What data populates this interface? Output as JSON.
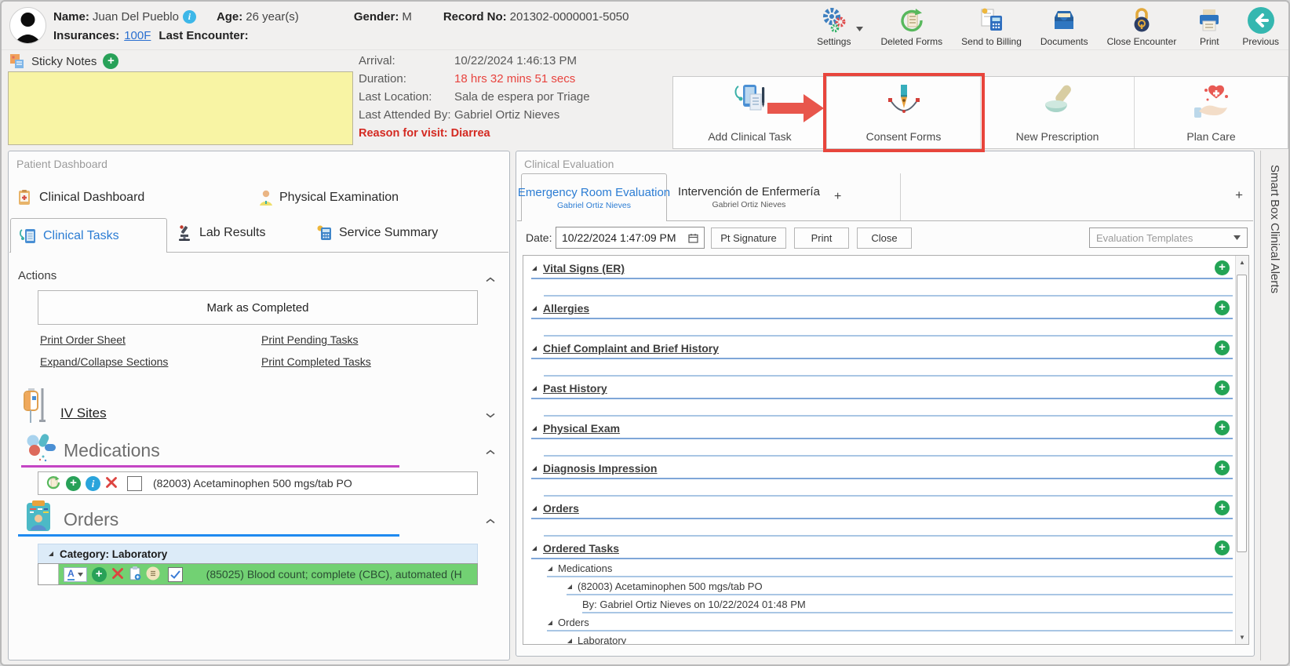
{
  "patient_header": {
    "name_label": "Name:",
    "name": "Juan Del Pueblo",
    "age_label": "Age:",
    "age": "26 year(s)",
    "gender_label": "Gender:",
    "gender": "M",
    "record_label": "Record No:",
    "record": "201302-0000001-5050",
    "insurances_label": "Insurances:",
    "insurances": "100F",
    "last_encounter_label": "Last Encounter:"
  },
  "toolbar": {
    "settings": "Settings",
    "deleted_forms": "Deleted Forms",
    "send_to_billing": "Send to Billing",
    "documents": "Documents",
    "close_encounter": "Close Encounter",
    "print": "Print",
    "previous": "Previous"
  },
  "sticky_notes": {
    "title": "Sticky Notes"
  },
  "encounter": {
    "arrival_label": "Arrival:",
    "arrival": "10/22/2024 1:46:13 PM",
    "duration_label": "Duration:",
    "duration": "18 hrs 32 mins 51 secs",
    "last_location_label": "Last Location:",
    "last_location": "Sala de espera por Triage",
    "last_attended_label": "Last Attended By:",
    "last_attended": "Gabriel Ortiz Nieves",
    "reason": "Reason for visit: Diarrea"
  },
  "quick_actions": {
    "add_clinical_task": "Add Clinical Task",
    "consent_forms": "Consent Forms",
    "new_prescription": "New Prescription",
    "plan_care": "Plan Care"
  },
  "patient_dashboard": {
    "title": "Patient Dashboard",
    "tab_clinical_dashboard": "Clinical Dashboard",
    "tab_physical_examination": "Physical Examination",
    "tab_clinical_tasks": "Clinical Tasks",
    "tab_lab_results": "Lab Results",
    "tab_service_summary": "Service Summary",
    "actions_title": "Actions",
    "mark_as_completed": "Mark as Completed",
    "print_order_sheet": "Print Order Sheet",
    "print_pending_tasks": "Print Pending Tasks",
    "expand_collapse_sections": "Expand/Collapse Sections",
    "print_completed_tasks": "Print Completed Tasks",
    "iv_sites_title": "IV Sites",
    "medications_title": "Medications",
    "medication_item": "(82003) Acetaminophen 500 mgs/tab PO",
    "orders_title": "Orders",
    "orders_category": "Category: Laboratory",
    "order_item": "(85025) Blood count; complete (CBC), automated (H",
    "order_tool_a": "A"
  },
  "clinical_evaluation": {
    "title": "Clinical Evaluation",
    "tabs": [
      {
        "label": "Emergency Room Evaluation",
        "author": "Gabriel Ortiz Nieves"
      },
      {
        "label": "Intervención de Enfermería",
        "author": "Gabriel Ortiz Nieves"
      }
    ],
    "add_tab": "+",
    "date_label": "Date:",
    "date_value": "10/22/2024 1:47:09 PM",
    "pt_signature_button": "Pt Signature",
    "print_button": "Print",
    "close_button": "Close",
    "templates_placeholder": "Evaluation Templates",
    "sections": [
      "Vital Signs (ER)",
      "Allergies",
      "Chief Complaint and Brief History",
      "Past History",
      "Physical Exam",
      "Diagnosis Impression",
      "Orders",
      "Ordered Tasks"
    ],
    "ordered_tasks_tree": {
      "medications": "Medications",
      "medication_item": "(82003) Acetaminophen 500 mgs/tab PO",
      "medication_by": "By: Gabriel Ortiz Nieves on 10/22/2024 01:48 PM",
      "orders": "Orders",
      "laboratory": "Laboratory"
    }
  },
  "side_panel": {
    "smart_box": "Smart Box",
    "clinical_alerts": "Clinical Alerts"
  },
  "colors": {
    "accent_blue": "#2b7cd3",
    "alert_red": "#e8433e",
    "medications_underline": "#c444c4",
    "orders_underline": "#1f8af0",
    "order_row_green": "#72d173",
    "category_row_blue": "#dcebf8",
    "sticky_note_yellow": "#f8f4a4",
    "highlight_red": "#e8453c",
    "plus_green": "#28a158"
  }
}
